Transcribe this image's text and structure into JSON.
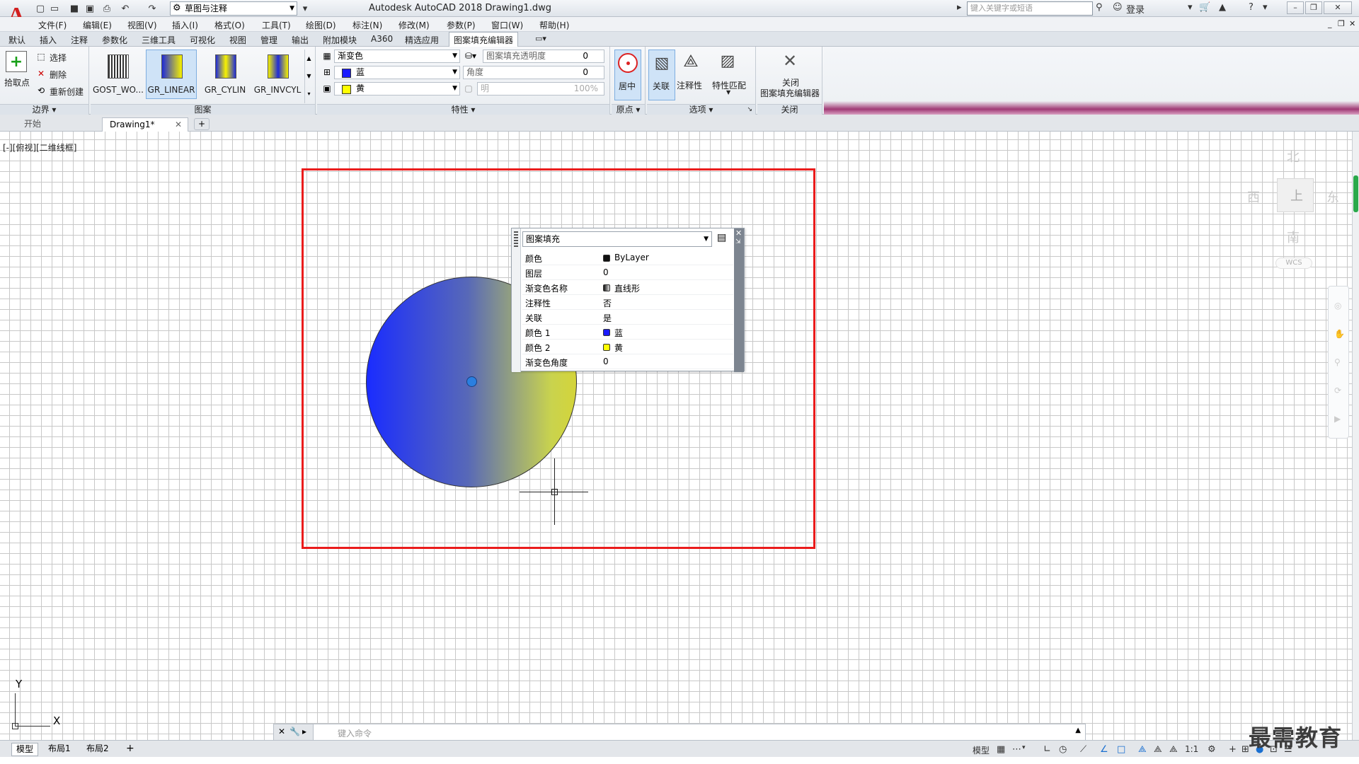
{
  "titlebar": {
    "workspace": "草图与注释",
    "title": "Autodesk AutoCAD 2018    Drawing1.dwg",
    "search_placeholder": "键入关键字或短语",
    "signin": "登录"
  },
  "menu": [
    "文件(F)",
    "编辑(E)",
    "视图(V)",
    "插入(I)",
    "格式(O)",
    "工具(T)",
    "绘图(D)",
    "标注(N)",
    "修改(M)",
    "参数(P)",
    "窗口(W)",
    "帮助(H)"
  ],
  "ribbon_tabs": [
    "默认",
    "插入",
    "注释",
    "参数化",
    "三维工具",
    "可视化",
    "视图",
    "管理",
    "输出",
    "附加模块",
    "A360",
    "精选应用",
    "图案填充编辑器"
  ],
  "ribbon": {
    "boundary": {
      "pick": "拾取点",
      "select": "选择",
      "remove": "删除",
      "recreate": "重新创建",
      "title": "边界"
    },
    "pattern": {
      "items": [
        "GOST_WO...",
        "GR_LINEAR",
        "GR_CYLIN",
        "GR_INVCYL"
      ],
      "selected": 1,
      "title": "图案"
    },
    "properties": {
      "type": "渐变色",
      "color1": "蓝",
      "color2": "黄",
      "transparency_label": "图案填充透明度",
      "transparency_value": "0",
      "angle_label": "角度",
      "angle_value": "0",
      "tint_label": "明",
      "tint_value": "100%",
      "title": "特性"
    },
    "origin": {
      "center": "居中",
      "title": "原点"
    },
    "options": {
      "assoc": "关联",
      "annot": "注释性",
      "match": "特性匹配",
      "title": "选项"
    },
    "close": {
      "label1": "关闭",
      "label2": "图案填充编辑器",
      "title": "关闭"
    }
  },
  "doc_tabs": [
    "开始",
    "Drawing1*"
  ],
  "viewport_label": "[-][俯视][二维线框]",
  "quick_props": {
    "title": "图案填充",
    "rows": [
      {
        "k": "颜色",
        "v": "ByLayer",
        "swatch": "#111111"
      },
      {
        "k": "图层",
        "v": "0"
      },
      {
        "k": "渐变色名称",
        "v": "直线形",
        "swatch": "gradient"
      },
      {
        "k": "注释性",
        "v": "否"
      },
      {
        "k": "关联",
        "v": "是"
      },
      {
        "k": "颜色 1",
        "v": "蓝",
        "swatch": "#1a1aff"
      },
      {
        "k": "颜色 2",
        "v": "黄",
        "swatch": "#ffff00"
      },
      {
        "k": "渐变色角度",
        "v": "0"
      }
    ]
  },
  "navcube": {
    "north": "北",
    "south": "南",
    "east": "东",
    "west": "西",
    "top": "上",
    "wcs": "WCS"
  },
  "ucs": {
    "x": "X",
    "y": "Y"
  },
  "cmdline": {
    "placeholder": "键入命令"
  },
  "layout_tabs": [
    "模型",
    "布局1",
    "布局2"
  ],
  "status": {
    "model": "模型",
    "scale": "1:1"
  },
  "watermark": "最需教育",
  "colors": {
    "rect": "#ea1c1c",
    "accent": "#d21f1f",
    "grid": "#c8c8c8"
  }
}
